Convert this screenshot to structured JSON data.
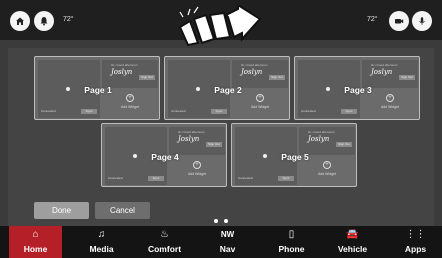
{
  "status_bar": {
    "left_temp": "72°",
    "right_temp": "72°"
  },
  "pages": [
    {
      "label": "Page 1",
      "card_caption": "Hi • Good afternoon",
      "card_name": "Joslyn",
      "card_tag": "Hi",
      "card_btn": "Sign Out",
      "add_label": "Add Widget",
      "map_status": "Connected",
      "map_btn": "Sync"
    },
    {
      "label": "Page 2",
      "card_caption": "Hi • Good afternoon",
      "card_name": "Joslyn",
      "card_tag": "Hi",
      "card_btn": "Sign Out",
      "add_label": "Add Widget",
      "map_status": "Connected",
      "map_btn": "Sync"
    },
    {
      "label": "Page 3",
      "card_caption": "Hi • Good afternoon",
      "card_name": "Joslyn",
      "card_tag": "Hi",
      "card_btn": "Sign Out",
      "add_label": "Add Widget",
      "map_status": "Connected",
      "map_btn": "Sync"
    },
    {
      "label": "Page 4",
      "card_caption": "Hi • Good afternoon",
      "card_name": "Joslyn",
      "card_tag": "Hi",
      "card_btn": "Sign Out",
      "add_label": "Add Widget",
      "map_status": "Connected",
      "map_btn": "Sync"
    },
    {
      "label": "Page 5",
      "card_caption": "Hi • Good afternoon",
      "card_name": "Joslyn",
      "card_tag": "Hi",
      "card_btn": "Sign Out",
      "add_label": "Add Widget",
      "map_status": "Connected",
      "map_btn": "Sync"
    }
  ],
  "actions": {
    "done": "Done",
    "cancel": "Cancel"
  },
  "nav": [
    {
      "label": "Home",
      "icon": "home-icon",
      "glyph": "⌂",
      "active": true
    },
    {
      "label": "Media",
      "icon": "music-icon",
      "glyph": "♫",
      "active": false
    },
    {
      "label": "Comfort",
      "icon": "comfort-icon",
      "glyph": "♨",
      "active": false
    },
    {
      "label": "Nav",
      "icon": "compass-icon",
      "glyph": "NW",
      "active": false
    },
    {
      "label": "Phone",
      "icon": "phone-icon",
      "glyph": "▯",
      "active": false
    },
    {
      "label": "Vehicle",
      "icon": "car-icon",
      "glyph": "🚘",
      "active": false
    },
    {
      "label": "Apps",
      "icon": "apps-grid-icon",
      "glyph": "⋮⋮",
      "active": false
    }
  ],
  "colors": {
    "active_nav": "#b51f28",
    "background": "#3b3b3b"
  }
}
